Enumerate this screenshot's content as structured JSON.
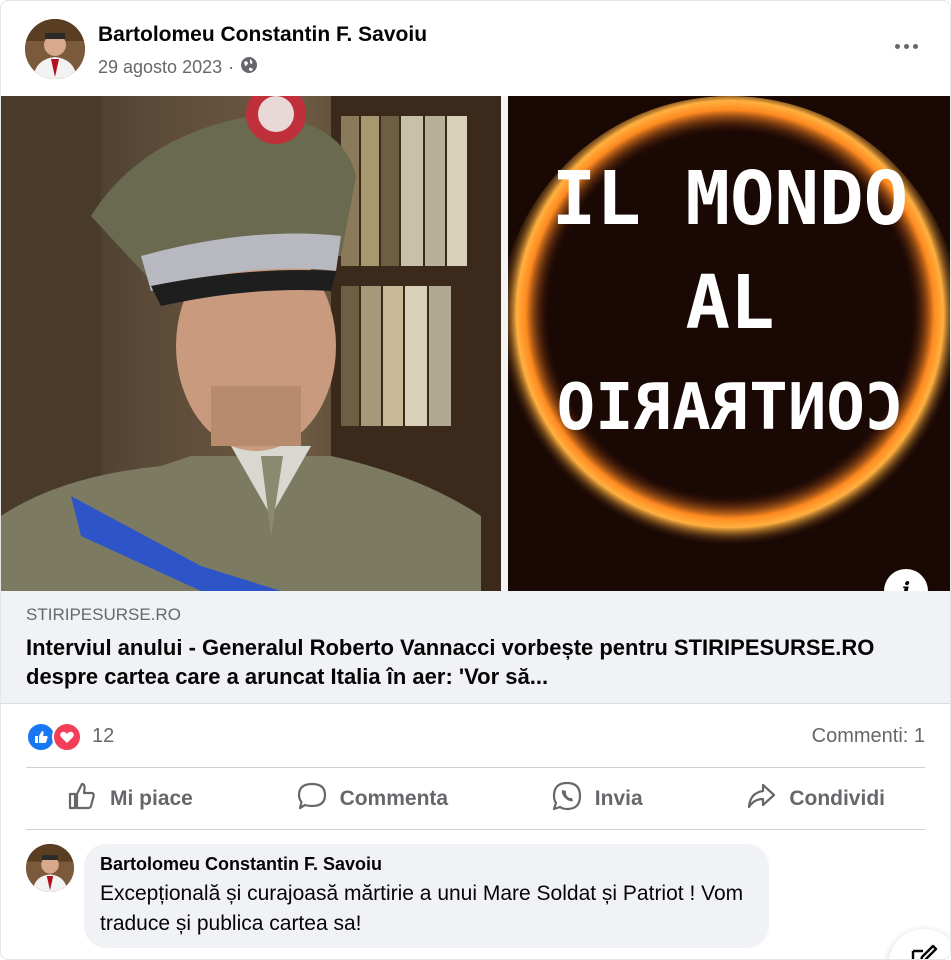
{
  "post": {
    "author": "Bartolomeu Constantin F. Savoiu",
    "date": "29 agosto 2023",
    "separator": "·",
    "privacy_icon": "globe-icon"
  },
  "link_preview": {
    "image_text": "IL MONDO\nAL\nCONTRARIO",
    "image_line1": "IL MONDO",
    "image_line2": "AL",
    "image_line3": "CONTRARIO",
    "domain": "STIRIPESURSE.RO",
    "title": "Interviul anului - Generalul Roberto Vannacci vorbește pentru STIRIPESURSE.RO despre cartea care a aruncat Italia în aer: 'Vor să..."
  },
  "reactions": {
    "count": "12",
    "types": [
      "like",
      "love"
    ],
    "comments_label": "Commenti: 1"
  },
  "actions": {
    "like": "Mi piace",
    "comment": "Commenta",
    "send": "Invia",
    "share": "Condividi"
  },
  "comment": {
    "author": "Bartolomeu Constantin F. Savoiu",
    "text": "Excepțională și curajoasă mărtirie a unui Mare Soldat și Patriot ! Vom traduce și publica cartea sa!"
  },
  "colors": {
    "accent": "#1877f2",
    "love": "#f33e58",
    "muted_text": "#65676b",
    "preview_bg": "#f0f2f5"
  }
}
